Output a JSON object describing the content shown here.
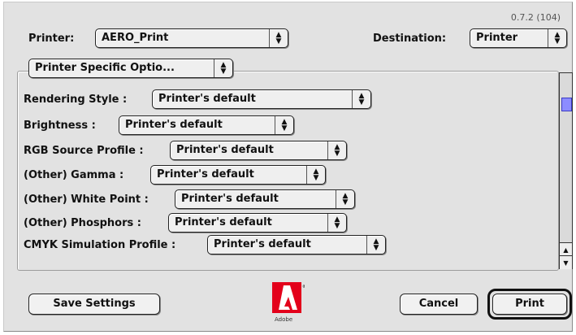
{
  "version": "0.7.2 (104)",
  "printer": {
    "label": "Printer:",
    "value": "AERO_Print"
  },
  "destination": {
    "label": "Destination:",
    "value": "Printer"
  },
  "panel_menu": {
    "value": "Printer Specific Optio..."
  },
  "options": [
    {
      "label": "Rendering Style :",
      "value": "Printer's default"
    },
    {
      "label": "Brightness :",
      "value": "Printer's default"
    },
    {
      "label": "RGB Source Profile :",
      "value": "Printer's default"
    },
    {
      "label": "(Other) Gamma :",
      "value": "Printer's default"
    },
    {
      "label": "(Other) White Point :",
      "value": "Printer's default"
    },
    {
      "label": "(Other) Phosphors :",
      "value": "Printer's default"
    },
    {
      "label": "CMYK Simulation Profile :",
      "value": "Printer's default"
    }
  ],
  "buttons": {
    "save": "Save Settings",
    "cancel": "Cancel",
    "print": "Print"
  },
  "logo": {
    "icon": "adobe-logo-icon",
    "brand_color": "#e3001b",
    "text": "Adobe"
  }
}
